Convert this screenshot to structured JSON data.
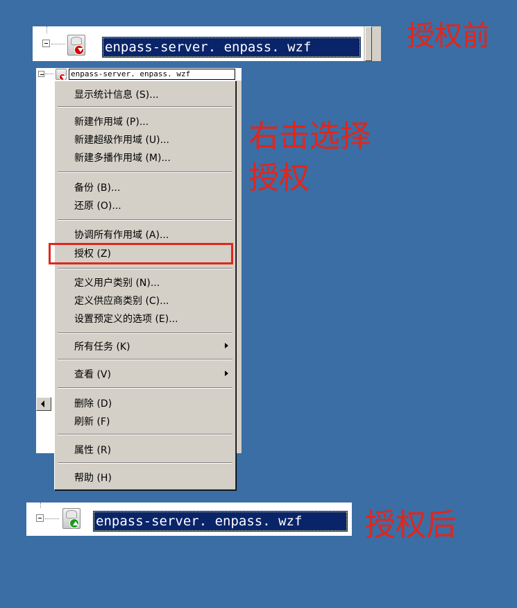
{
  "before": {
    "server_name": "enpass-server. enpass. wzf",
    "annotation": "授权前"
  },
  "context": {
    "server_name": "enpass-server. enpass. wzf",
    "annotation_line1": "右击选择",
    "annotation_line2": "授权",
    "menu": {
      "show_stats": "显示统计信息 (S)...",
      "new_scope": "新建作用域 (P)...",
      "new_superscope": "新建超级作用域 (U)...",
      "new_multicast_scope": "新建多播作用域 (M)...",
      "backup": "备份 (B)...",
      "restore": "还原 (O)...",
      "reconcile_all_scopes": "协调所有作用域 (A)...",
      "authorize": "授权 (Z)",
      "define_user_classes": "定义用户类别 (N)...",
      "define_vendor_classes": "定义供应商类别 (C)...",
      "set_predefined_options": "设置预定义的选项 (E)...",
      "all_tasks": "所有任务 (K)",
      "view": "查看 (V)",
      "delete": "删除 (D)",
      "refresh": "刷新 (F)",
      "properties": "属性 (R)",
      "help": "帮助 (H)"
    }
  },
  "after": {
    "server_name": "enpass-server. enpass. wzf",
    "annotation": "授权后"
  },
  "colors": {
    "background": "#3a6ea5",
    "annotation": "#e1261c",
    "selection": "#0a246a",
    "menu_bg": "#d4d0c8",
    "badge_unauthorized": "#d40000",
    "badge_authorized": "#1c9a1c"
  },
  "icons": {
    "tree_expander": "minus-box",
    "server_unauthorized": "dhcp-server-red-down-arrow",
    "server_authorized": "dhcp-server-green-up-arrow",
    "submenu": "right-triangle"
  }
}
